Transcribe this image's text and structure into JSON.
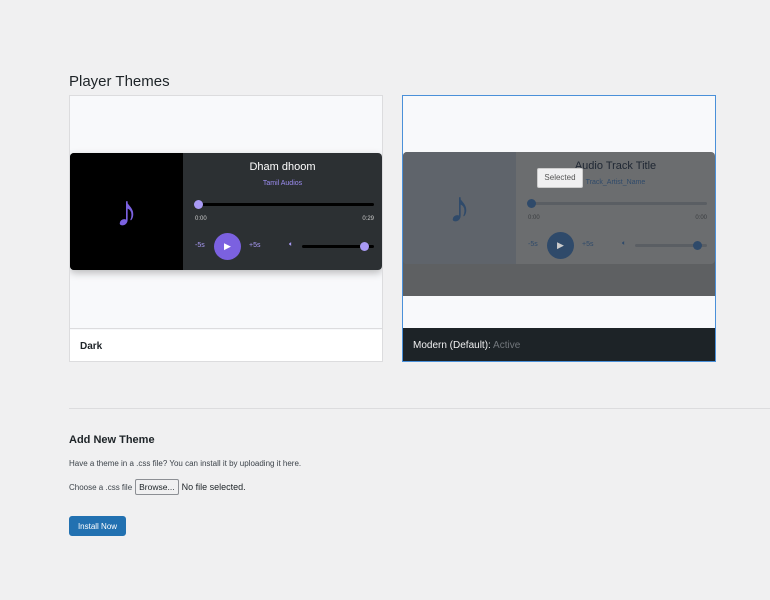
{
  "page_title": "Player Themes",
  "themes": [
    {
      "name": "Dark",
      "status": "",
      "preview": {
        "title": "Dham dhoom",
        "artist": "Tamil Audios",
        "current_time": "0:00",
        "duration": "0:29",
        "rewind": "-5s",
        "forward": "+5s",
        "progress": 0,
        "volume": 0.8
      }
    },
    {
      "name": "Modern (Default)",
      "status": "Active",
      "separator": ":",
      "badge": "Selected",
      "preview": {
        "title": "Audio Track Title",
        "artist": "Track_Artist_Name",
        "current_time": "0:00",
        "duration": "0:00",
        "rewind": "-5s",
        "forward": "+5s",
        "progress": 0,
        "volume": 0.8
      }
    }
  ],
  "add_theme": {
    "heading": "Add New Theme",
    "description": "Have a theme in a .css file? You can install it by uploading it here.",
    "file_label": "Choose a .css file",
    "browse_label": "Browse...",
    "no_file": "No file selected.",
    "install_label": "Install Now"
  },
  "colors": {
    "accent": "#2271b1",
    "dark_purple": "#7b61e0",
    "modern_blue": "#3c5a80"
  }
}
